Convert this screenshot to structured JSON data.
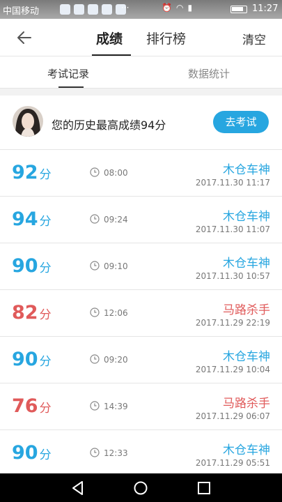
{
  "status_bar": {
    "carrier": "中国移动",
    "more": "···",
    "time": "11:27"
  },
  "header": {
    "tab_scores": "成绩",
    "tab_rank": "排行榜",
    "clear": "清空"
  },
  "subtabs": {
    "records": "考试记录",
    "stats": "数据统计"
  },
  "history": {
    "text": "您的历史最高成绩94分",
    "button": "去考试"
  },
  "colors": {
    "pass": "#27a6e0",
    "fail": "#e05a5a"
  },
  "records": [
    {
      "score": "92",
      "unit": "分",
      "duration": "08:00",
      "title": "木仓车神",
      "date": "2017.11.30   11:17",
      "status": "pass"
    },
    {
      "score": "94",
      "unit": "分",
      "duration": "09:24",
      "title": "木仓车神",
      "date": "2017.11.30   11:07",
      "status": "pass"
    },
    {
      "score": "90",
      "unit": "分",
      "duration": "09:10",
      "title": "木仓车神",
      "date": "2017.11.30   10:57",
      "status": "pass"
    },
    {
      "score": "82",
      "unit": "分",
      "duration": "12:06",
      "title": "马路杀手",
      "date": "2017.11.29   22:19",
      "status": "fail"
    },
    {
      "score": "90",
      "unit": "分",
      "duration": "09:20",
      "title": "木仓车神",
      "date": "2017.11.29   10:04",
      "status": "pass"
    },
    {
      "score": "76",
      "unit": "分",
      "duration": "14:39",
      "title": "马路杀手",
      "date": "2017.11.29   06:07",
      "status": "fail"
    },
    {
      "score": "90",
      "unit": "分",
      "duration": "12:33",
      "title": "木仓车神",
      "date": "2017.11.29   05:51",
      "status": "pass"
    }
  ]
}
